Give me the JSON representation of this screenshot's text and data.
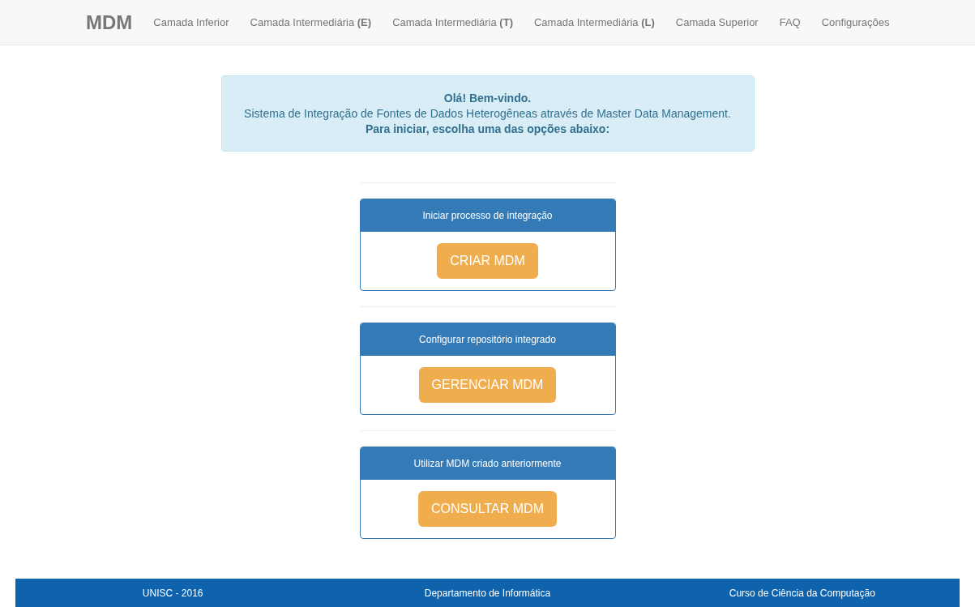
{
  "navbar": {
    "brand": "MDM",
    "items": [
      {
        "label": "Camada Inferior"
      },
      {
        "label": "Camada Intermediária **(E)**"
      },
      {
        "label": "Camada Intermediária **(T)**"
      },
      {
        "label": "Camada Intermediária **(L)**"
      },
      {
        "label": "Camada Superior"
      },
      {
        "label": "FAQ"
      },
      {
        "label": "Configurações"
      }
    ]
  },
  "welcome": {
    "title": "Olá! Bem-vindo.",
    "text": "Sistema de Integração de Fontes de Dados Heterogêneas através de Master Data Management.",
    "prompt": "Para iniciar, escolha uma das opções abaixo:"
  },
  "panels": [
    {
      "heading": "Iniciar processo de integração",
      "button": "CRIAR MDM"
    },
    {
      "heading": "Configurar repositório integrado",
      "button": "GERENCIAR MDM"
    },
    {
      "heading": "Utilizar MDM criado anteriormente",
      "button": "CONSULTAR MDM"
    }
  ],
  "footer": [
    "UNISC - 2016",
    "Departamento de Informática",
    "Curso de Ciência da Computação"
  ]
}
